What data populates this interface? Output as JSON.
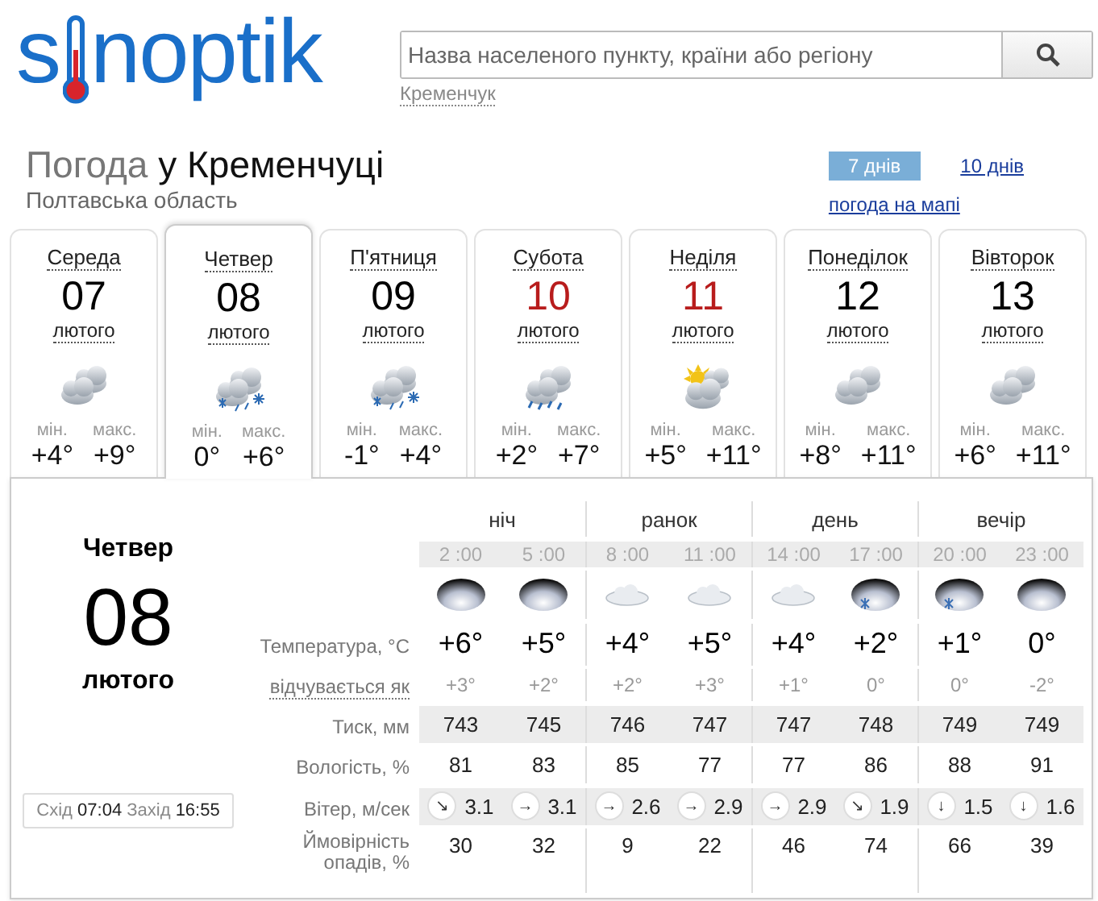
{
  "logo": {
    "before": "s",
    "after": "noptik"
  },
  "search": {
    "placeholder": "Назва населеного пункту, країни або регіону",
    "recent": "Кременчук"
  },
  "heading": {
    "prefix": "Погода",
    "place": "у Кременчуці",
    "region": "Полтавська область"
  },
  "tabs": [
    {
      "label": "7 днів",
      "selected": true
    },
    {
      "label": "10 днів",
      "selected": false
    }
  ],
  "map_link": "погода на мапі",
  "days": [
    {
      "name": "Середа",
      "date": "07",
      "month": "лютого",
      "kind": "cloudy",
      "min_label": "мін.",
      "max_label": "макс.",
      "min": "+4°",
      "max": "+9°",
      "selected": false,
      "holiday": false
    },
    {
      "name": "Четвер",
      "date": "08",
      "month": "лютого",
      "kind": "snow",
      "min_label": "мін.",
      "max_label": "макс.",
      "min": "0°",
      "max": "+6°",
      "selected": true,
      "holiday": false
    },
    {
      "name": "П'ятниця",
      "date": "09",
      "month": "лютого",
      "kind": "snow",
      "min_label": "мін.",
      "max_label": "макс.",
      "min": "-1°",
      "max": "+4°",
      "selected": false,
      "holiday": false
    },
    {
      "name": "Субота",
      "date": "10",
      "month": "лютого",
      "kind": "rain",
      "min_label": "мін.",
      "max_label": "макс.",
      "min": "+2°",
      "max": "+7°",
      "selected": false,
      "holiday": true
    },
    {
      "name": "Неділя",
      "date": "11",
      "month": "лютого",
      "kind": "partly_sunny",
      "min_label": "мін.",
      "max_label": "макс.",
      "min": "+5°",
      "max": "+11°",
      "selected": false,
      "holiday": true
    },
    {
      "name": "Понеділок",
      "date": "12",
      "month": "лютого",
      "kind": "cloudy",
      "min_label": "мін.",
      "max_label": "макс.",
      "min": "+8°",
      "max": "+11°",
      "selected": false,
      "holiday": false
    },
    {
      "name": "Вівторок",
      "date": "13",
      "month": "лютого",
      "kind": "cloudy",
      "min_label": "мін.",
      "max_label": "макс.",
      "min": "+6°",
      "max": "+11°",
      "selected": false,
      "holiday": false
    }
  ],
  "detail": {
    "day_name": "Четвер",
    "date": "08",
    "month": "лютого",
    "sunrise_label": "Схід",
    "sunrise": "07:04",
    "sunset_label": "Захід",
    "sunset": "16:55",
    "periods": [
      "ніч",
      "ранок",
      "день",
      "вечір"
    ],
    "hours": [
      "2 :00",
      "5 :00",
      "8 :00",
      "11 :00",
      "14 :00",
      "17 :00",
      "20 :00",
      "23 :00"
    ],
    "icons": [
      {
        "kind": "overcast"
      },
      {
        "kind": "overcast"
      },
      {
        "kind": "light_cloud"
      },
      {
        "kind": "light_cloud"
      },
      {
        "kind": "light_cloud"
      },
      {
        "kind": "overcast_snow"
      },
      {
        "kind": "overcast_snow"
      },
      {
        "kind": "overcast"
      }
    ],
    "labels": {
      "temperature": "Температура, °C",
      "feels_like": "відчувається як",
      "pressure": "Тиск, мм",
      "humidity": "Вологість, %",
      "wind": "Вітер, м/сек",
      "precipitation": "Ймовірність опадів, %"
    },
    "temperature": [
      "+6°",
      "+5°",
      "+4°",
      "+5°",
      "+4°",
      "+2°",
      "+1°",
      "0°"
    ],
    "feels_like": [
      "+3°",
      "+2°",
      "+2°",
      "+3°",
      "+1°",
      "0°",
      "0°",
      "-2°"
    ],
    "pressure": [
      "743",
      "745",
      "746",
      "747",
      "747",
      "748",
      "749",
      "749"
    ],
    "humidity": [
      "81",
      "83",
      "85",
      "77",
      "77",
      "86",
      "88",
      "91"
    ],
    "wind": [
      {
        "direction": "↘",
        "speed": "3.1"
      },
      {
        "direction": "→",
        "speed": "3.1"
      },
      {
        "direction": "→",
        "speed": "2.6"
      },
      {
        "direction": "→",
        "speed": "2.9"
      },
      {
        "direction": "→",
        "speed": "2.9"
      },
      {
        "direction": "↘",
        "speed": "1.9"
      },
      {
        "direction": "↓",
        "speed": "1.5"
      },
      {
        "direction": "↓",
        "speed": "1.6"
      }
    ],
    "precipitation": [
      "30",
      "32",
      "9",
      "22",
      "46",
      "74",
      "66",
      "39"
    ]
  }
}
